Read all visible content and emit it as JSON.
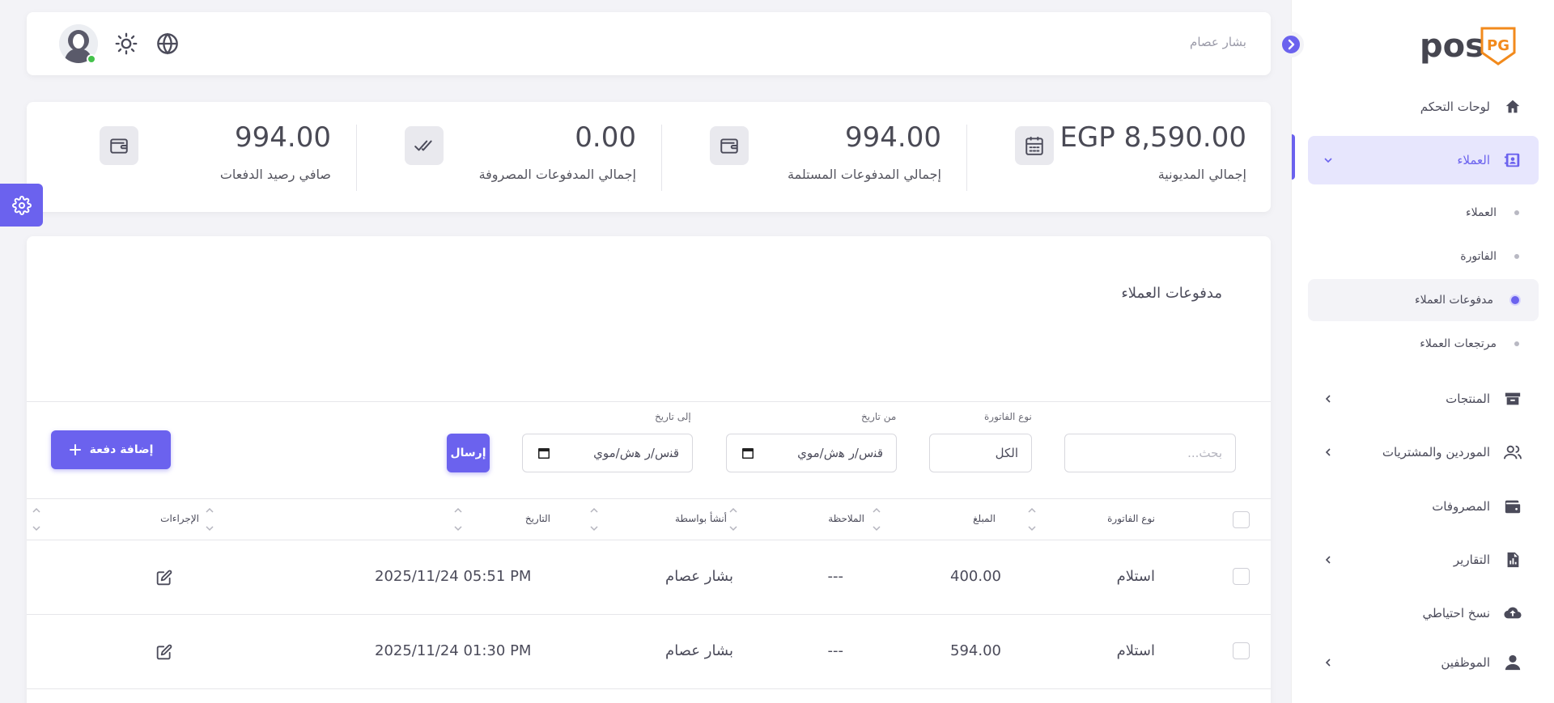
{
  "brand": {
    "name": "pos",
    "emblem": "PG"
  },
  "header": {
    "user_name": "بشار عصام"
  },
  "stats": [
    {
      "value": "EGP 8,590.00",
      "label": "إجمالي المديونية",
      "icon": "calendar-icon"
    },
    {
      "value": "994.00",
      "label": "إجمالي المدفوعات المستلمة",
      "icon": "wallet-icon"
    },
    {
      "value": "0.00",
      "label": "إجمالي المدفوعات المصروفة",
      "icon": "double-check-icon"
    },
    {
      "value": "994.00",
      "label": "صافي رصيد الدفعات",
      "icon": "wallet-icon"
    }
  ],
  "sidebar": {
    "items": [
      {
        "label": "لوحات التحكم",
        "icon": "home-icon"
      },
      {
        "label": "العملاء",
        "icon": "contacts-icon"
      },
      {
        "label": "المنتجات",
        "icon": "archive-icon"
      },
      {
        "label": "الموردين والمشتريات",
        "icon": "users-icon"
      },
      {
        "label": "المصروفات",
        "icon": "wallet-icon"
      },
      {
        "label": "التقارير",
        "icon": "report-icon"
      },
      {
        "label": "نسخ احتياطي",
        "icon": "cloud-upload-icon"
      },
      {
        "label": "الموظفين",
        "icon": "user-icon"
      }
    ],
    "subitems": [
      {
        "label": "العملاء"
      },
      {
        "label": "الفاتورة"
      },
      {
        "label": "مدفوعات العملاء"
      },
      {
        "label": "مرتجعات العملاء"
      }
    ]
  },
  "main": {
    "title": "مدفوعات العملاء",
    "filters": {
      "search_placeholder": "بحث...",
      "invoice_type_label": "نوع الفاتورة",
      "invoice_type_value": "الكل",
      "from_date_label": "من تاريخ",
      "from_date_placeholder": "ﻗﻨﺱ/ﺭ ﻫﺵ/ﻣﻮﻱ",
      "to_date_label": "إلى تاريخ",
      "to_date_placeholder": "ﻗﻨﺱ/ﺭ ﻫﺵ/ﻣﻮﻱ",
      "send_label": "إرسال",
      "add_label": "إضافة دفعة"
    },
    "table": {
      "headers": [
        "نوع الفاتورة",
        "المبلغ",
        "الملاحظة",
        "أنشأ بواسطة",
        "التاريخ",
        "الإجراءات"
      ],
      "rows": [
        {
          "type": "استلام",
          "amount": "400.00",
          "note": "---",
          "created_by": "بشار عصام",
          "date": "2025/11/24 05:51 PM"
        },
        {
          "type": "استلام",
          "amount": "594.00",
          "note": "---",
          "created_by": "بشار عصام",
          "date": "2025/11/24 01:30 PM"
        }
      ]
    }
  },
  "colors": {
    "accent": "#6b62ee",
    "online": "#44c24b"
  }
}
